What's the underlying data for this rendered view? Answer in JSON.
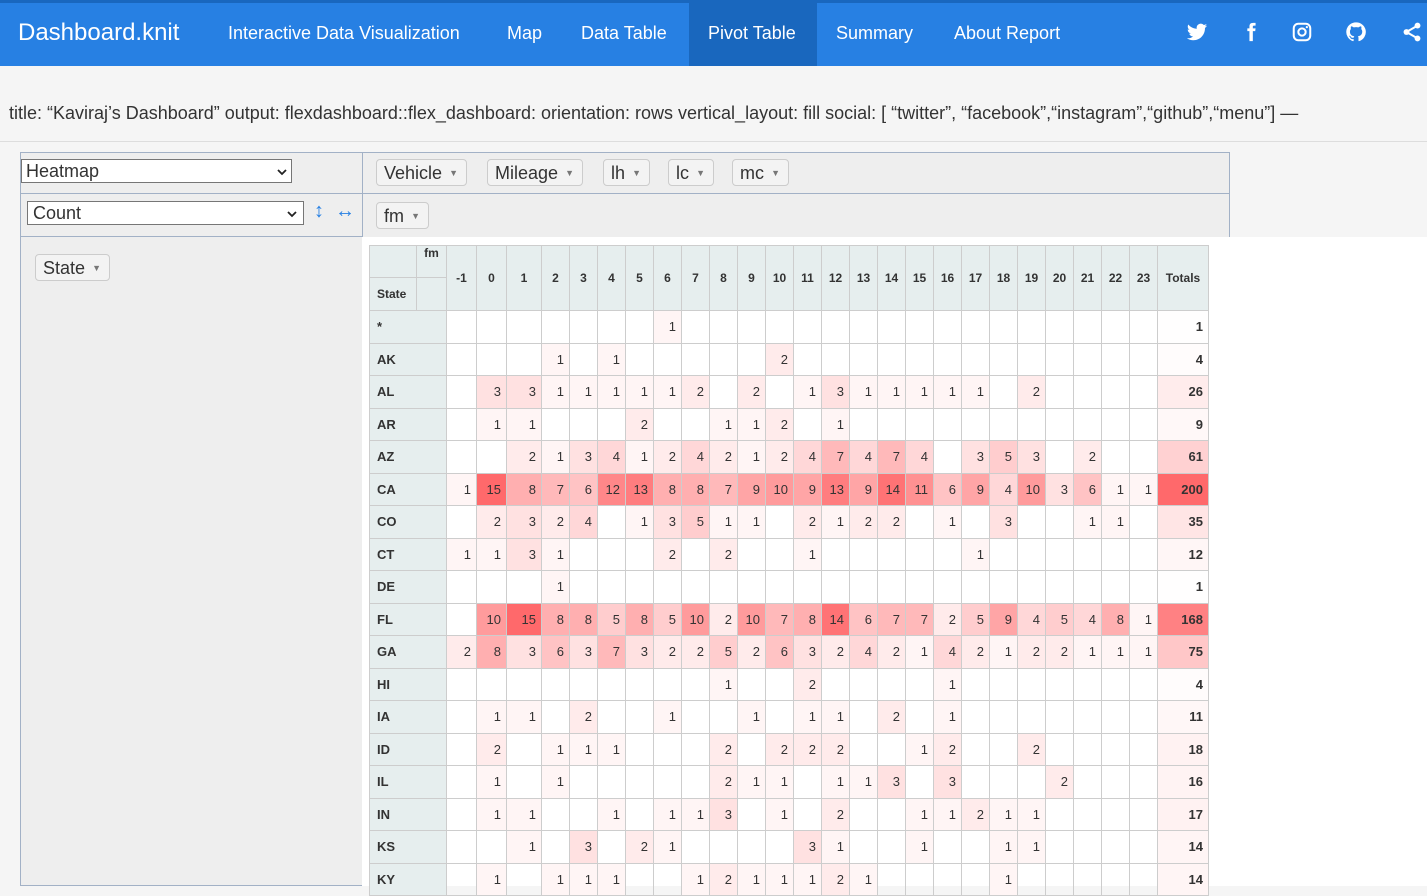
{
  "nav": {
    "brand": "Dashboard.knit",
    "items": [
      "Interactive Data Visualization",
      "Map",
      "Data Table",
      "Pivot Table",
      "Summary",
      "About Report"
    ],
    "active": "Pivot Table",
    "social_icons": [
      "twitter-icon",
      "facebook-icon",
      "instagram-icon",
      "github-icon",
      "share-icon"
    ]
  },
  "yaml_line": "title: “Kaviraj’s Dashboard” output: flexdashboard::flex_dashboard: orientation: rows vertical_layout: fill social: [ “twitter”, “facebook”,“instagram”,“github”,“menu”] —",
  "pivot": {
    "renderer": "Heatmap",
    "aggregator": "Count",
    "unused_attrs": [
      "Vehicle",
      "Mileage",
      "lh",
      "lc",
      "mc"
    ],
    "col_attrs": [
      "fm"
    ],
    "row_attrs": [
      "State"
    ],
    "col_attr_label": "fm",
    "row_attr_label": "State",
    "columns": [
      "-1",
      "0",
      "1",
      "2",
      "3",
      "4",
      "5",
      "6",
      "7",
      "8",
      "9",
      "10",
      "11",
      "12",
      "13",
      "14",
      "15",
      "16",
      "17",
      "18",
      "19",
      "20",
      "21",
      "22",
      "23"
    ],
    "totals_label": "Totals",
    "heat_color": "#f8696b",
    "rows": [
      {
        "state": "*",
        "cells": [
          "",
          "",
          "",
          "",
          "",
          "",
          "",
          "1",
          "",
          "",
          "",
          "",
          "",
          "",
          "",
          "",
          "",
          "",
          "",
          "",
          "",
          "",
          "",
          "",
          ""
        ],
        "total": "1"
      },
      {
        "state": "AK",
        "cells": [
          "",
          "",
          "",
          "1",
          "",
          "1",
          "",
          "",
          "",
          "",
          "",
          "2",
          "",
          "",
          "",
          "",
          "",
          "",
          "",
          "",
          "",
          "",
          "",
          "",
          ""
        ],
        "total": "4"
      },
      {
        "state": "AL",
        "cells": [
          "",
          "3",
          "3",
          "1",
          "1",
          "1",
          "1",
          "1",
          "2",
          "",
          "2",
          "",
          "1",
          "3",
          "1",
          "1",
          "1",
          "1",
          "1",
          "",
          "2",
          "",
          "",
          "",
          ""
        ],
        "total": "26"
      },
      {
        "state": "AR",
        "cells": [
          "",
          "1",
          "1",
          "",
          "",
          "",
          "2",
          "",
          "",
          "1",
          "1",
          "2",
          "",
          "1",
          "",
          "",
          "",
          "",
          "",
          "",
          "",
          "",
          "",
          "",
          ""
        ],
        "total": "9"
      },
      {
        "state": "AZ",
        "cells": [
          "",
          "",
          "2",
          "1",
          "3",
          "4",
          "1",
          "2",
          "4",
          "2",
          "1",
          "2",
          "4",
          "7",
          "4",
          "7",
          "4",
          "",
          "3",
          "5",
          "3",
          "",
          "2",
          "",
          ""
        ],
        "total": "61"
      },
      {
        "state": "CA",
        "cells": [
          "1",
          "15",
          "8",
          "7",
          "6",
          "12",
          "13",
          "8",
          "8",
          "7",
          "9",
          "10",
          "9",
          "13",
          "9",
          "14",
          "11",
          "6",
          "9",
          "4",
          "10",
          "3",
          "6",
          "1",
          "1"
        ],
        "total": "200"
      },
      {
        "state": "CO",
        "cells": [
          "",
          "2",
          "3",
          "2",
          "4",
          "",
          "1",
          "3",
          "5",
          "1",
          "1",
          "",
          "2",
          "1",
          "2",
          "2",
          "",
          "1",
          "",
          "3",
          "",
          "",
          "1",
          "1",
          ""
        ],
        "total": "35"
      },
      {
        "state": "CT",
        "cells": [
          "1",
          "1",
          "3",
          "1",
          "",
          "",
          "",
          "2",
          "",
          "2",
          "",
          "",
          "1",
          "",
          "",
          "",
          "",
          "",
          "1",
          "",
          "",
          "",
          "",
          "",
          ""
        ],
        "total": "12"
      },
      {
        "state": "DE",
        "cells": [
          "",
          "",
          "",
          "1",
          "",
          "",
          "",
          "",
          "",
          "",
          "",
          "",
          "",
          "",
          "",
          "",
          "",
          "",
          "",
          "",
          "",
          "",
          "",
          "",
          ""
        ],
        "total": "1"
      },
      {
        "state": "FL",
        "cells": [
          "",
          "10",
          "15",
          "8",
          "8",
          "5",
          "8",
          "5",
          "10",
          "2",
          "10",
          "7",
          "8",
          "14",
          "6",
          "7",
          "7",
          "2",
          "5",
          "9",
          "4",
          "5",
          "4",
          "8",
          "1"
        ],
        "total": "168"
      },
      {
        "state": "GA",
        "cells": [
          "2",
          "8",
          "3",
          "6",
          "3",
          "7",
          "3",
          "2",
          "2",
          "5",
          "2",
          "6",
          "3",
          "2",
          "4",
          "2",
          "1",
          "4",
          "2",
          "1",
          "2",
          "2",
          "1",
          "1",
          "1"
        ],
        "total": "75"
      },
      {
        "state": "HI",
        "cells": [
          "",
          "",
          "",
          "",
          "",
          "",
          "",
          "",
          "",
          "1",
          "",
          "",
          "2",
          "",
          "",
          "",
          "",
          "1",
          "",
          "",
          "",
          "",
          "",
          "",
          ""
        ],
        "total": "4"
      },
      {
        "state": "IA",
        "cells": [
          "",
          "1",
          "1",
          "",
          "2",
          "",
          "",
          "1",
          "",
          "",
          "1",
          "",
          "1",
          "1",
          "",
          "2",
          "",
          "1",
          "",
          "",
          "",
          "",
          "",
          "",
          ""
        ],
        "total": "11"
      },
      {
        "state": "ID",
        "cells": [
          "",
          "2",
          "",
          "1",
          "1",
          "1",
          "",
          "",
          "",
          "2",
          "",
          "2",
          "2",
          "2",
          "",
          "",
          "1",
          "2",
          "",
          "",
          "2",
          "",
          "",
          "",
          ""
        ],
        "total": "18"
      },
      {
        "state": "IL",
        "cells": [
          "",
          "1",
          "",
          "1",
          "",
          "",
          "",
          "",
          "",
          "2",
          "1",
          "1",
          "",
          "1",
          "1",
          "3",
          "",
          "3",
          "",
          "",
          "",
          "2",
          "",
          "",
          ""
        ],
        "total": "16"
      },
      {
        "state": "IN",
        "cells": [
          "",
          "1",
          "1",
          "",
          "",
          "1",
          "",
          "1",
          "1",
          "3",
          "",
          "1",
          "",
          "2",
          "",
          "",
          "1",
          "1",
          "2",
          "1",
          "1",
          "",
          "",
          "",
          ""
        ],
        "total": "17"
      },
      {
        "state": "KS",
        "cells": [
          "",
          "",
          "1",
          "",
          "3",
          "",
          "2",
          "1",
          "",
          "",
          "",
          "",
          "3",
          "1",
          "",
          "",
          "1",
          "",
          "",
          "1",
          "1",
          "",
          "",
          "",
          ""
        ],
        "total": "14"
      },
      {
        "state": "KY",
        "cells": [
          "",
          "1",
          "",
          "1",
          "1",
          "1",
          "",
          "",
          "1",
          "2",
          "1",
          "1",
          "1",
          "2",
          "1",
          "",
          "",
          "",
          "",
          "1",
          "",
          "",
          "",
          "",
          ""
        ],
        "total": "14"
      }
    ]
  }
}
